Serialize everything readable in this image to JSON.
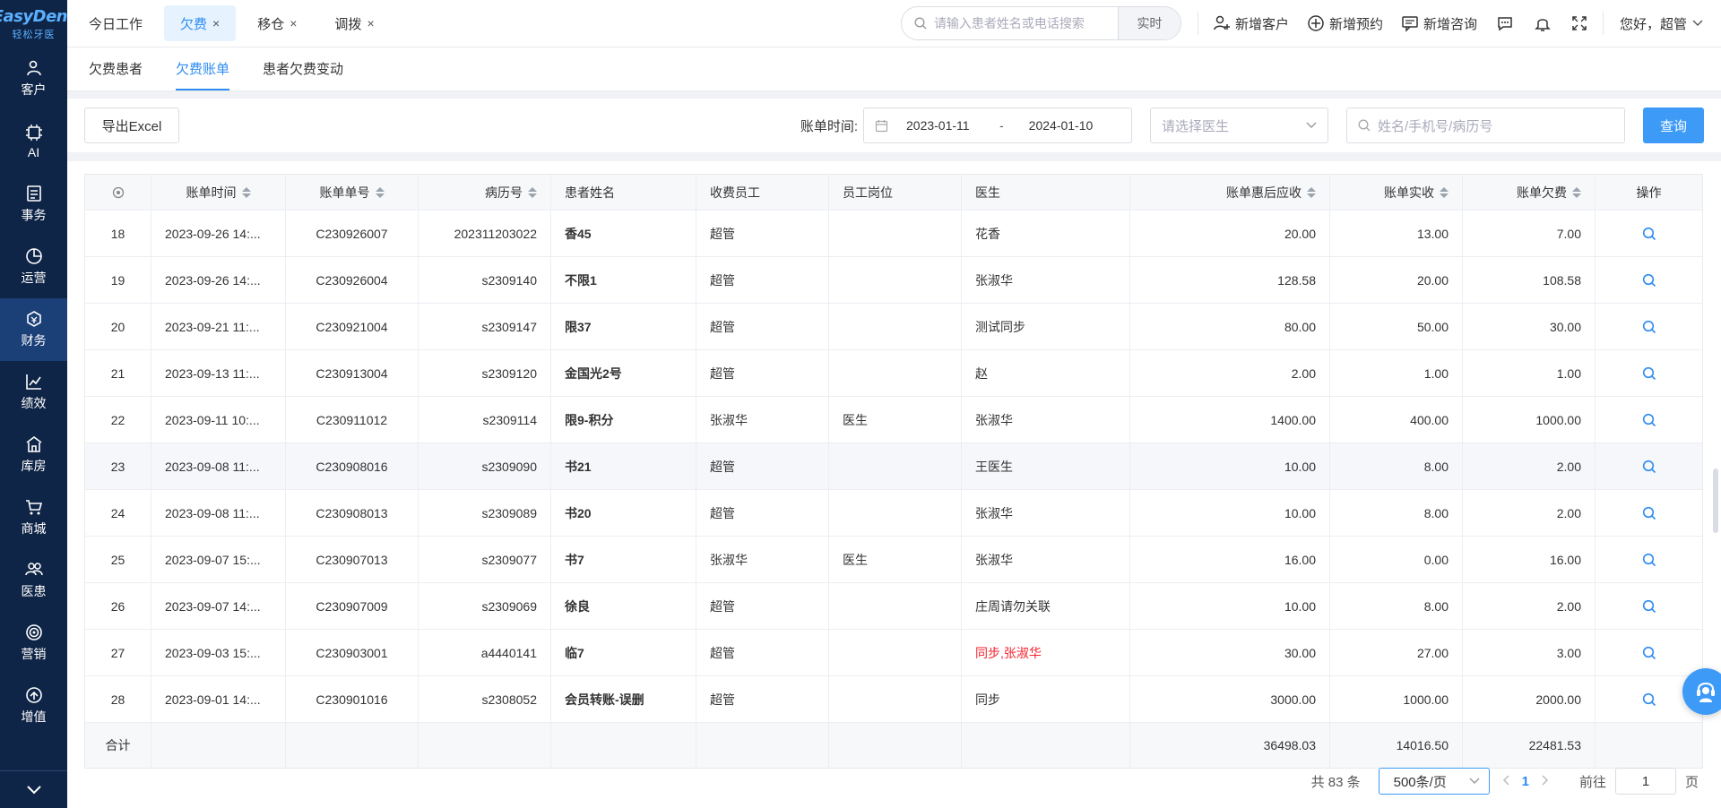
{
  "app": {
    "brand": "EasyDent",
    "brand_sub": "轻松牙医"
  },
  "sidebar": {
    "items": [
      {
        "label": "客户",
        "icon": "customer-icon"
      },
      {
        "label": "AI",
        "icon": "ai-chip-icon"
      },
      {
        "label": "事务",
        "icon": "task-icon"
      },
      {
        "label": "运营",
        "icon": "operation-icon"
      },
      {
        "label": "财务",
        "icon": "finance-icon",
        "active": true
      },
      {
        "label": "绩效",
        "icon": "performance-icon"
      },
      {
        "label": "库房",
        "icon": "warehouse-icon"
      },
      {
        "label": "商城",
        "icon": "cart-icon"
      },
      {
        "label": "医患",
        "icon": "doctor-patient-icon"
      },
      {
        "label": "营销",
        "icon": "marketing-icon"
      },
      {
        "label": "增值",
        "icon": "value-added-icon"
      }
    ]
  },
  "topbar": {
    "tabs": [
      {
        "label": "今日工作",
        "closable": false,
        "active": false
      },
      {
        "label": "欠费",
        "closable": true,
        "active": true
      },
      {
        "label": "移仓",
        "closable": true,
        "active": false
      },
      {
        "label": "调拨",
        "closable": true,
        "active": false
      }
    ],
    "close_glyph": "×",
    "search_placeholder": "请输入患者姓名或电话搜索",
    "search_button": "实时",
    "actions": {
      "add_customer": "新增客户",
      "add_appointment": "新增预约",
      "add_consult": "新增咨询"
    },
    "greeting": "您好，超管"
  },
  "subtabs": [
    {
      "label": "欠费患者",
      "active": false
    },
    {
      "label": "欠费账单",
      "active": true
    },
    {
      "label": "患者欠费变动",
      "active": false
    }
  ],
  "filters": {
    "export_label": "导出Excel",
    "date_label": "账单时间:",
    "date_start": "2023-01-11",
    "date_sep": "-",
    "date_end": "2024-01-10",
    "doctor_placeholder": "请选择医生",
    "keyword_placeholder": "姓名/手机号/病历号",
    "query_label": "查询"
  },
  "table": {
    "headers": {
      "time": "账单时间",
      "no": "账单单号",
      "record": "病历号",
      "name": "患者姓名",
      "staff": "收费员工",
      "position": "员工岗位",
      "doctor": "医生",
      "due": "账单惠后应收",
      "paid": "账单实收",
      "owe": "账单欠费",
      "op": "操作"
    },
    "rows": [
      {
        "idx": "18",
        "time": "2023-09-26 14:...",
        "no": "C230926007",
        "record": "202311203022",
        "name": "香45",
        "staff": "超管",
        "position": "",
        "doctor": "花香",
        "due": "20.00",
        "paid": "13.00",
        "owe": "7.00"
      },
      {
        "idx": "19",
        "time": "2023-09-26 14:...",
        "no": "C230926004",
        "record": "s2309140",
        "name": "不限1",
        "staff": "超管",
        "position": "",
        "doctor": "张淑华",
        "due": "128.58",
        "paid": "20.00",
        "owe": "108.58"
      },
      {
        "idx": "20",
        "time": "2023-09-21 11:...",
        "no": "C230921004",
        "record": "s2309147",
        "name": "限37",
        "staff": "超管",
        "position": "",
        "doctor": "测试同步",
        "due": "80.00",
        "paid": "50.00",
        "owe": "30.00"
      },
      {
        "idx": "21",
        "time": "2023-09-13 11:...",
        "no": "C230913004",
        "record": "s2309120",
        "name": "金国光2号",
        "staff": "超管",
        "position": "",
        "doctor": "赵",
        "due": "2.00",
        "paid": "1.00",
        "owe": "1.00"
      },
      {
        "idx": "22",
        "time": "2023-09-11 10:...",
        "no": "C230911012",
        "record": "s2309114",
        "name": "限9-积分",
        "staff": "张淑华",
        "position": "医生",
        "doctor": "张淑华",
        "due": "1400.00",
        "paid": "400.00",
        "owe": "1000.00"
      },
      {
        "idx": "23",
        "time": "2023-09-08 11:...",
        "no": "C230908016",
        "record": "s2309090",
        "name": "书21",
        "staff": "超管",
        "position": "",
        "doctor": "王医生",
        "due": "10.00",
        "paid": "8.00",
        "owe": "2.00"
      },
      {
        "idx": "24",
        "time": "2023-09-08 11:...",
        "no": "C230908013",
        "record": "s2309089",
        "name": "书20",
        "staff": "超管",
        "position": "",
        "doctor": "张淑华",
        "due": "10.00",
        "paid": "8.00",
        "owe": "2.00"
      },
      {
        "idx": "25",
        "time": "2023-09-07 15:...",
        "no": "C230907013",
        "record": "s2309077",
        "name": "书7",
        "staff": "张淑华",
        "position": "医生",
        "doctor": "张淑华",
        "due": "16.00",
        "paid": "0.00",
        "owe": "16.00"
      },
      {
        "idx": "26",
        "time": "2023-09-07 14:...",
        "no": "C230907009",
        "record": "s2309069",
        "name": "徐良",
        "staff": "超管",
        "position": "",
        "doctor": "庄周请勿关联",
        "due": "10.00",
        "paid": "8.00",
        "owe": "2.00"
      },
      {
        "idx": "27",
        "time": "2023-09-03 15:...",
        "no": "C230903001",
        "record": "a4440141",
        "name": "临7",
        "staff": "超管",
        "position": "",
        "doctor": "同步,张淑华",
        "doctor_color": "#f5222d",
        "due": "30.00",
        "paid": "27.00",
        "owe": "3.00"
      },
      {
        "idx": "28",
        "time": "2023-09-01 14:...",
        "no": "C230901016",
        "record": "s2308052",
        "name": "会员转账-误删",
        "staff": "超管",
        "position": "",
        "doctor": "同步",
        "due": "3000.00",
        "paid": "1000.00",
        "owe": "2000.00"
      }
    ],
    "total": {
      "label": "合计",
      "due": "36498.03",
      "paid": "14016.50",
      "owe": "22481.53"
    }
  },
  "pager": {
    "total_text": "共 83 条",
    "page_size": "500条/页",
    "current_page": "1",
    "goto_label": "前往",
    "goto_value": "1",
    "page_suffix": "页"
  },
  "colors": {
    "accent": "#2f8cf0",
    "sidebar_bg": "#0f2547",
    "danger": "#f5222d"
  }
}
